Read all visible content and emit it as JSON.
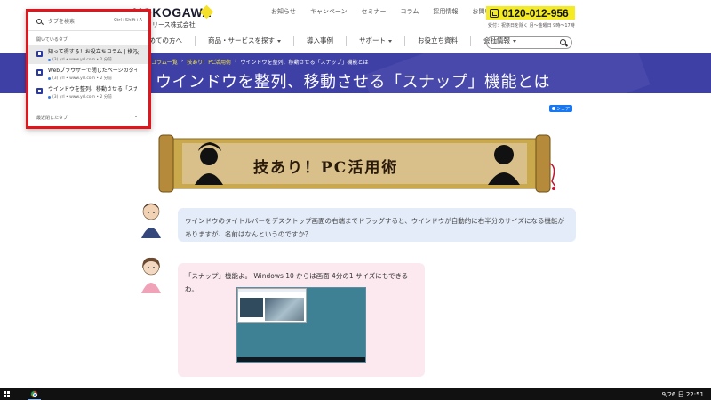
{
  "header": {
    "logo_text": "YOKOGAWA",
    "logo_sub": "レンタリース株式会社",
    "top_links": [
      "お知らせ",
      "キャンペーン",
      "セミナー",
      "コラム",
      "採用情報",
      "お問い合わせ"
    ],
    "phone": "0120-012-956",
    "phone_hours": "受付：祝祭日を除く 月～金曜日 9時～17時",
    "nav": [
      "初めての方へ",
      "商品・サービスを探す",
      "導入事例",
      "サポート",
      "お役立ち資料",
      "会社情報"
    ],
    "search_placeholder": "検索",
    "colors": {
      "accent": "#f4eb22",
      "banner": "#3f40a6"
    }
  },
  "banner": {
    "breadcrumbs": [
      "コラム一覧",
      "技あり！PC活用術",
      "ウインドウを整列、移動させる「スナップ」機能とは"
    ],
    "title": "ウインドウを整列、移動させる「スナップ」機能とは"
  },
  "share_label": "シェア",
  "scroll_title": "技あり！PC活用術",
  "chat": {
    "question": "ウインドウのタイトルバーをデスクトップ画面の右端までドラッグすると、ウインドウが自動的に右半分のサイズになる機能がありますが、名前はなんというのですか？",
    "answer": "「スナップ」機能よ。 Windows 10 からは画面 4分の1 サイズにもできるわ。"
  },
  "tab_search": {
    "placeholder": "タブを検索",
    "shortcut": "Ctrl+Shift+A",
    "open_tabs_label": "開いているタブ",
    "tabs": [
      {
        "title": "知って得する！お役立ちコラム | 横河...",
        "meta": "(3) yrl • www.yrl.com • 2 分前",
        "active": true
      },
      {
        "title": "Webブラウザーで閉じたページのタイト...",
        "meta": "(3) yrl • www.yrl.com • 2 分前",
        "active": false
      },
      {
        "title": "ウインドウを整列、移動させる「スナッ...",
        "meta": "(3) yrl • www.yrl.com • 2 分前",
        "active": false
      }
    ],
    "recent_label": "最近閉じたタブ",
    "highlight_color": "#e3141b"
  },
  "taskbar": {
    "clock": "9/26 日 22:51"
  }
}
